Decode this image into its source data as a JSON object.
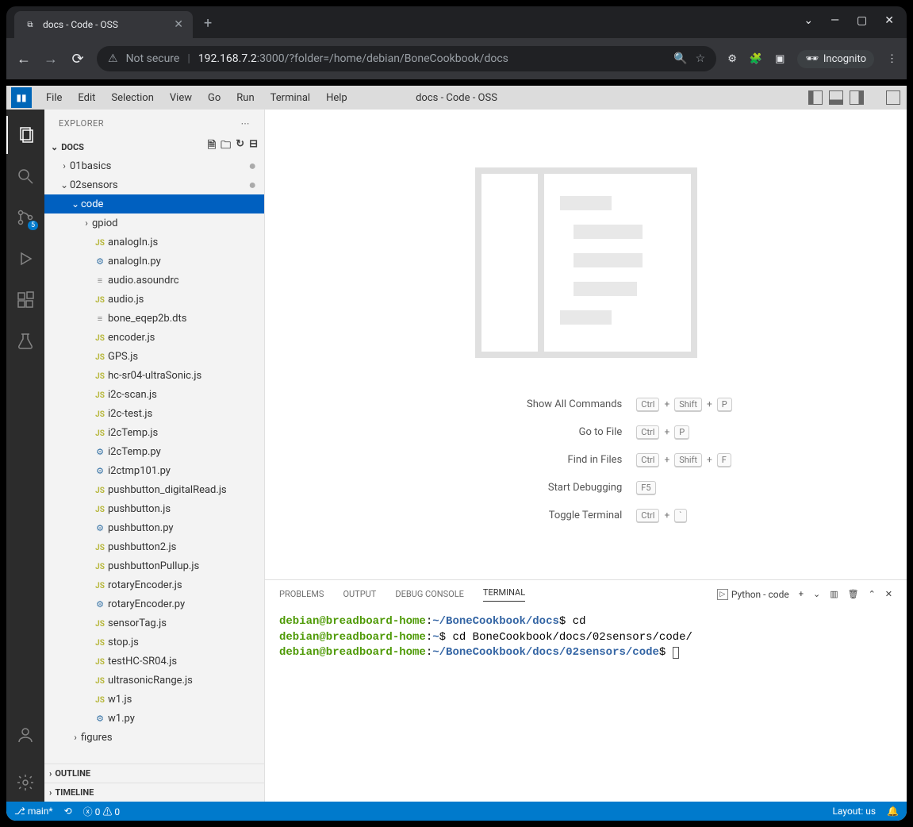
{
  "browser": {
    "tab_title": "docs - Code - OSS",
    "url_insecure": "Not secure",
    "url_host": "192.168.7.2",
    "url_path": ":3000/?folder=/home/debian/BoneCookbook/docs",
    "incognito": "Incognito"
  },
  "menu": {
    "items": [
      "File",
      "Edit",
      "Selection",
      "View",
      "Go",
      "Run",
      "Terminal",
      "Help"
    ],
    "title": "docs - Code - OSS"
  },
  "activity": {
    "scm_badge": "5"
  },
  "explorer": {
    "title": "EXPLORER",
    "root": "DOCS",
    "tree": [
      {
        "name": "01basics",
        "kind": "folder",
        "depth": 1,
        "expanded": false,
        "dirty": true
      },
      {
        "name": "02sensors",
        "kind": "folder",
        "depth": 1,
        "expanded": true,
        "dirty": true
      },
      {
        "name": "code",
        "kind": "folder",
        "depth": 2,
        "expanded": true,
        "selected": true
      },
      {
        "name": "gpiod",
        "kind": "folder",
        "depth": 3,
        "expanded": false
      },
      {
        "name": "analogIn.js",
        "kind": "js",
        "depth": 3
      },
      {
        "name": "analogIn.py",
        "kind": "py",
        "depth": 3
      },
      {
        "name": "audio.asoundrc",
        "kind": "txt",
        "depth": 3
      },
      {
        "name": "audio.js",
        "kind": "js",
        "depth": 3
      },
      {
        "name": "bone_eqep2b.dts",
        "kind": "txt",
        "depth": 3
      },
      {
        "name": "encoder.js",
        "kind": "js",
        "depth": 3
      },
      {
        "name": "GPS.js",
        "kind": "js",
        "depth": 3
      },
      {
        "name": "hc-sr04-ultraSonic.js",
        "kind": "js",
        "depth": 3
      },
      {
        "name": "i2c-scan.js",
        "kind": "js",
        "depth": 3
      },
      {
        "name": "i2c-test.js",
        "kind": "js",
        "depth": 3
      },
      {
        "name": "i2cTemp.js",
        "kind": "js",
        "depth": 3
      },
      {
        "name": "i2cTemp.py",
        "kind": "py",
        "depth": 3
      },
      {
        "name": "i2ctmp101.py",
        "kind": "py",
        "depth": 3
      },
      {
        "name": "pushbutton_digitalRead.js",
        "kind": "js",
        "depth": 3
      },
      {
        "name": "pushbutton.js",
        "kind": "js",
        "depth": 3
      },
      {
        "name": "pushbutton.py",
        "kind": "py",
        "depth": 3
      },
      {
        "name": "pushbutton2.js",
        "kind": "js",
        "depth": 3
      },
      {
        "name": "pushbuttonPullup.js",
        "kind": "js",
        "depth": 3
      },
      {
        "name": "rotaryEncoder.js",
        "kind": "js",
        "depth": 3
      },
      {
        "name": "rotaryEncoder.py",
        "kind": "py",
        "depth": 3
      },
      {
        "name": "sensorTag.js",
        "kind": "js",
        "depth": 3
      },
      {
        "name": "stop.js",
        "kind": "js",
        "depth": 3
      },
      {
        "name": "testHC-SR04.js",
        "kind": "js",
        "depth": 3
      },
      {
        "name": "ultrasonicRange.js",
        "kind": "js",
        "depth": 3
      },
      {
        "name": "w1.js",
        "kind": "js",
        "depth": 3
      },
      {
        "name": "w1.py",
        "kind": "py",
        "depth": 3
      },
      {
        "name": "figures",
        "kind": "folder",
        "depth": 2,
        "expanded": false
      }
    ],
    "outline": "OUTLINE",
    "timeline": "TIMELINE"
  },
  "welcome": {
    "shortcuts": [
      {
        "label": "Show All Commands",
        "keys": [
          "Ctrl",
          "+",
          "Shift",
          "+",
          "P"
        ]
      },
      {
        "label": "Go to File",
        "keys": [
          "Ctrl",
          "+",
          "P"
        ]
      },
      {
        "label": "Find in Files",
        "keys": [
          "Ctrl",
          "+",
          "Shift",
          "+",
          "F"
        ]
      },
      {
        "label": "Start Debugging",
        "keys": [
          "F5"
        ]
      },
      {
        "label": "Toggle Terminal",
        "keys": [
          "Ctrl",
          "+",
          "`"
        ]
      }
    ]
  },
  "panel": {
    "tabs": [
      "PROBLEMS",
      "OUTPUT",
      "DEBUG CONSOLE",
      "TERMINAL"
    ],
    "active_tab": "TERMINAL",
    "terminal_name": "Python - code",
    "lines": [
      {
        "user": "debian@breadboard-home",
        "path": "~/BoneCookbook/docs",
        "cmd": "cd"
      },
      {
        "user": "debian@breadboard-home",
        "path": "~",
        "cmd": "cd BoneCookbook/docs/02sensors/code/"
      },
      {
        "user": "debian@breadboard-home",
        "path": "~/BoneCookbook/docs/02sensors/code",
        "cmd": ""
      }
    ]
  },
  "status": {
    "branch": "main*",
    "errors": "0",
    "warnings": "0",
    "layout": "Layout: us"
  }
}
